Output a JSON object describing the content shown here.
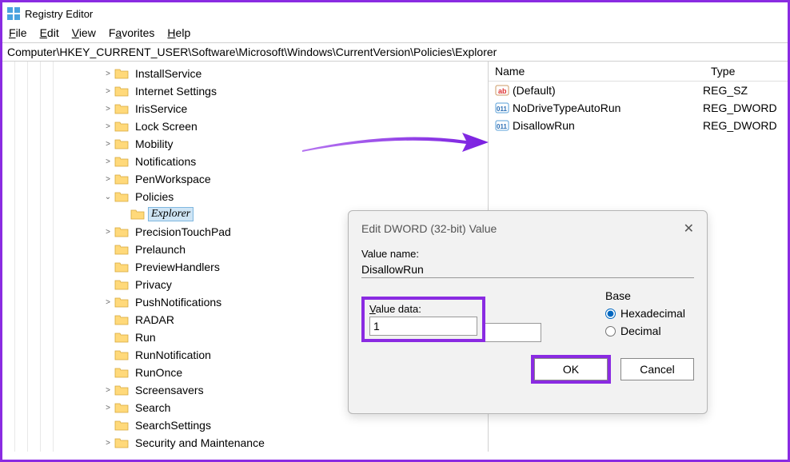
{
  "window": {
    "title": "Registry Editor"
  },
  "menu": [
    "File",
    "Edit",
    "View",
    "Favorites",
    "Help"
  ],
  "address": "Computer\\HKEY_CURRENT_USER\\Software\\Microsoft\\Windows\\CurrentVersion\\Policies\\Explorer",
  "tree": {
    "indent": 120,
    "items": [
      {
        "expand": ">",
        "label": "InstallService"
      },
      {
        "expand": ">",
        "label": "Internet Settings"
      },
      {
        "expand": ">",
        "label": "IrisService"
      },
      {
        "expand": ">",
        "label": "Lock Screen"
      },
      {
        "expand": ">",
        "label": "Mobility"
      },
      {
        "expand": ">",
        "label": "Notifications"
      },
      {
        "expand": ">",
        "label": "PenWorkspace"
      },
      {
        "expand": "v",
        "label": "Policies"
      },
      {
        "expand": "",
        "label": "Explorer",
        "selected": true,
        "childIndent": 20
      },
      {
        "expand": ">",
        "label": "PrecisionTouchPad"
      },
      {
        "expand": "",
        "label": "Prelaunch"
      },
      {
        "expand": "",
        "label": "PreviewHandlers"
      },
      {
        "expand": "",
        "label": "Privacy"
      },
      {
        "expand": ">",
        "label": "PushNotifications"
      },
      {
        "expand": "",
        "label": "RADAR"
      },
      {
        "expand": "",
        "label": "Run"
      },
      {
        "expand": "",
        "label": "RunNotification"
      },
      {
        "expand": "",
        "label": "RunOnce"
      },
      {
        "expand": ">",
        "label": "Screensavers"
      },
      {
        "expand": ">",
        "label": "Search"
      },
      {
        "expand": "",
        "label": "SearchSettings"
      },
      {
        "expand": ">",
        "label": "Security and Maintenance"
      }
    ]
  },
  "values": {
    "headers": {
      "name": "Name",
      "type": "Type"
    },
    "rows": [
      {
        "icon": "string",
        "name": "(Default)",
        "type": "REG_SZ"
      },
      {
        "icon": "dword",
        "name": "NoDriveTypeAutoRun",
        "type": "REG_DWORD"
      },
      {
        "icon": "dword",
        "name": "DisallowRun",
        "type": "REG_DWORD"
      }
    ]
  },
  "dialog": {
    "title": "Edit DWORD (32-bit) Value",
    "value_name_label": "Value name:",
    "value_name": "DisallowRun",
    "value_data_label": "Value data:",
    "value_data": "1",
    "base_label": "Base",
    "base_hex": "Hexadecimal",
    "base_dec": "Decimal",
    "ok": "OK",
    "cancel": "Cancel"
  }
}
